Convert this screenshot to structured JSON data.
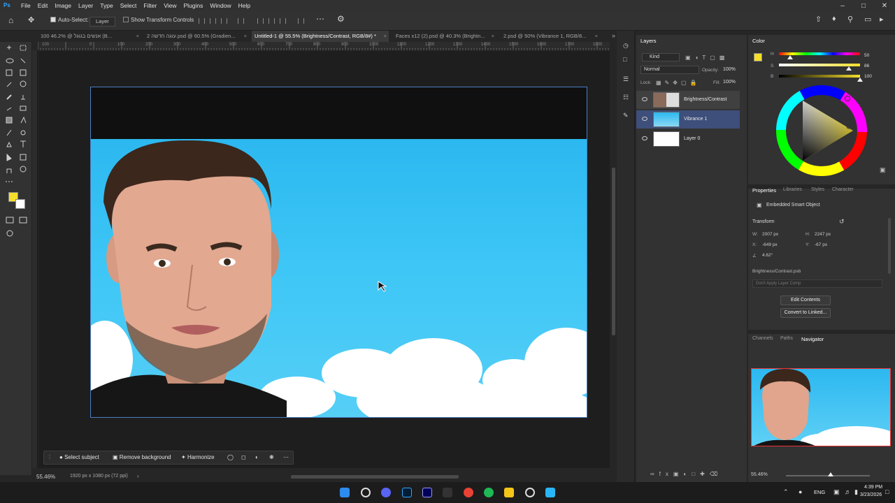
{
  "menubar": {
    "logo": "Ps",
    "items": [
      "File",
      "Edit",
      "Image",
      "Layer",
      "Type",
      "Select",
      "Filter",
      "View",
      "Plugins",
      "Window",
      "Help"
    ]
  },
  "options_bar": {
    "auto_select_label": "Auto-Select:",
    "auto_select_target": "Layer",
    "show_transform_label": "Show Transform Controls"
  },
  "tabs": [
    {
      "label": "100 אנשים בגוגל @ 46.2% (B..."
    },
    {
      "label": "2 עוגה חדשה.psd @ 60.5% (Gradien..."
    },
    {
      "label": "Untitled-1 @ 55.5% (Brightness/Contrast, RGB/8#) *"
    },
    {
      "label": "Faces x12 (2).psd @ 40.3% (Brightn..."
    },
    {
      "label": "2.psd @ 50% (Vibrance 1, RGB/8..."
    }
  ],
  "ruler": {
    "labels": [
      "100",
      "50",
      "0",
      "50",
      "100",
      "150",
      "200",
      "250",
      "300",
      "350",
      "400",
      "450",
      "500",
      "550",
      "600",
      "650",
      "700",
      "750",
      "800",
      "850",
      "900",
      "950",
      "1000",
      "1050",
      "1100",
      "1150",
      "1200",
      "1250",
      "1300",
      "1350",
      "1400",
      "1450",
      "1500",
      "1550",
      "1600",
      "1650",
      "1700",
      "1750",
      "1800",
      "1850",
      "1900",
      "1950"
    ]
  },
  "context_bar": {
    "select_subject": "Select subject",
    "remove_background": "Remove background",
    "harmonize": "Harmonize"
  },
  "status": {
    "zoom": "55.46%",
    "doc_size": "1920 px x 1080 px (72 ppi)"
  },
  "layers_panel": {
    "title": "Layers",
    "filter": "Kind",
    "blend_mode": "Normal",
    "opacity_label": "Opacity:",
    "opacity_value": "100%",
    "lock_label": "Lock:",
    "fill_label": "Fill:",
    "fill_value": "100%",
    "layers": [
      {
        "name": "Brightness/Contrast",
        "state": "highlighted"
      },
      {
        "name": "Vibrance 1",
        "state": "selected"
      },
      {
        "name": "Layer 0",
        "state": "normal"
      }
    ]
  },
  "color_panel": {
    "title": "Color",
    "h_label": "H",
    "s_label": "S",
    "b_label": "B",
    "h_value": "50",
    "s_value": "86",
    "b_value": "100",
    "foreground": "#f6df2b",
    "background": "#ffffff",
    "h_fraction": 0.14,
    "s_fraction": 0.86,
    "b_fraction": 1.0
  },
  "properties_panel": {
    "tabs": [
      "Properties",
      "Libraries",
      "Styles",
      "Character"
    ],
    "kind": "Embedded Smart Object",
    "transform_label": "Transform",
    "w_label": "W:",
    "w_value": "2007 px",
    "h_label": "H:",
    "h_value": "2247 px",
    "x_label": "X:",
    "x_value": "-649 px",
    "y_label": "Y:",
    "y_value": "-67 px",
    "angle_value": "4.62°",
    "filename": "Brightness/Contrast.psb",
    "layer_comp": "Don't Apply Layer Comp",
    "edit_contents": "Edit Contents",
    "convert_linked": "Convert to Linked..."
  },
  "navigator_panel": {
    "tabs": [
      "Channels",
      "Paths",
      "Navigator"
    ],
    "zoom": "55.46%"
  },
  "taskbar": {
    "lang": "ENG",
    "time": "4:39 PM",
    "date": "3/23/2026"
  }
}
